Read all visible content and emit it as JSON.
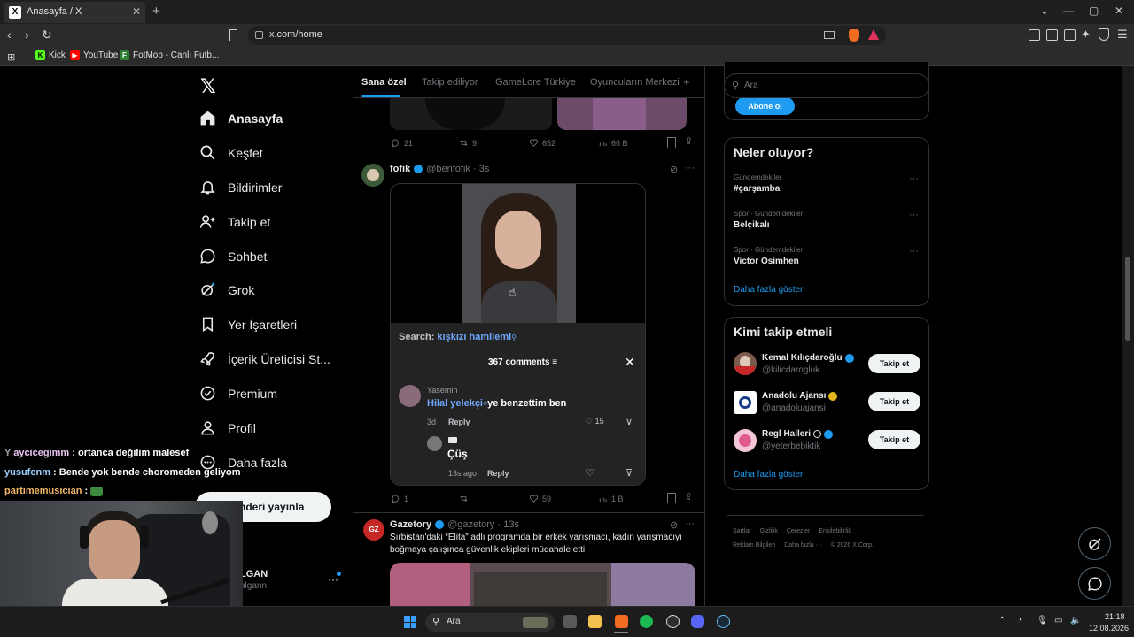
{
  "browser": {
    "tab_title": "Anasayfa / X",
    "url": "x.com/home",
    "bookmarks": [
      "Kick",
      "YouTube",
      "FotMob - Canlı Futb..."
    ]
  },
  "nav": {
    "items": [
      "Anasayfa",
      "Keşfet",
      "Bildirimler",
      "Takip et",
      "Sohbet",
      "Grok",
      "Yer İşaretleri",
      "İçerik Üreticisi St...",
      "Premium",
      "Profil",
      "Daha fazla"
    ],
    "post_button": "Gönderi yayınla",
    "post_button_visible": "nderi yayınla",
    "account_name": "LGAN",
    "account_handle": "algann"
  },
  "feed": {
    "tabs": [
      "Sana özel",
      "Takip ediliyor",
      "GameLore Türkiye",
      "Oyuncuların Merkezi"
    ],
    "post0": {
      "replies": "21",
      "reposts": "9",
      "likes": "652",
      "views": "66 B"
    },
    "post1": {
      "name": "fofik",
      "handle": "@benfofik · 3s",
      "tiktok": {
        "search_label": "Search:",
        "search_term": "kışkızı hamilemi",
        "comments_count": "367 comments",
        "comment1": {
          "user": "Yasemin",
          "link": "Hilal yelekçi",
          "text": "ye benzettim ben",
          "age": "3d",
          "reply": "Reply",
          "likes": "15"
        },
        "comment2": {
          "text": "Çüş",
          "age": "13s ago",
          "reply": "Reply"
        }
      },
      "metrics": {
        "replies": "1",
        "likes": "59",
        "views": "1 B"
      }
    },
    "post2": {
      "name": "Gazetory",
      "handle": "@gazetory · 13s",
      "avatar_text": "GZ",
      "text": "Sırbistan'daki “Elita” adlı programda bir erkek yarışmacı, kadın yarışmacıyı boğmaya çalışınca güvenlik ekipleri müdahale etti."
    }
  },
  "right": {
    "search_placeholder": "Ara",
    "subscribe": "Abone ol",
    "trends_title": "Neler oluyor?",
    "trends": [
      {
        "ctx": "Gündemdekiler",
        "title": "#çarşamba"
      },
      {
        "ctx": "Spor · Gündemdekiler",
        "title": "Belçikalı"
      },
      {
        "ctx": "Spor · Gündemdekiler",
        "title": "Victor Osimhen"
      }
    ],
    "show_more": "Daha fazla göster",
    "follow_title": "Kimi takip etmeli",
    "follow": [
      {
        "name": "Kemal Kılıçdaroğlu",
        "handle": "@kilicdarogluk",
        "button": "Takip et"
      },
      {
        "name": "Anadolu Ajansı",
        "handle": "@anadoluajansi",
        "button": "Takip et"
      },
      {
        "name": "Regl Halleri",
        "handle": "@yeterbebiktik",
        "button": "Takip et"
      }
    ],
    "footer_row1": [
      "Şartlar",
      "Gizlilik",
      "Çerezler",
      "Erişilebilirlik"
    ],
    "footer_row2": [
      "Reklam Bilgileri",
      "Daha fazla ···",
      "© 2026 X Corp."
    ]
  },
  "chat": [
    {
      "user": "aycicegimm",
      "msg": ": ortanca değilim malesef",
      "color": "#e8c3f0"
    },
    {
      "user": "yusufcnm",
      "msg": ": Bende yok bende choromeden geliyom",
      "color": "#9ad0ff"
    },
    {
      "user": "partimemusician",
      "msg": ":",
      "color": "#f5b86a"
    }
  ],
  "taskbar": {
    "search": "Ara",
    "time": "21:18",
    "date": "12.08.2026"
  },
  "colors": {
    "accent": "#1d9bf0",
    "bg": "#000000",
    "border": "#2f3336"
  }
}
